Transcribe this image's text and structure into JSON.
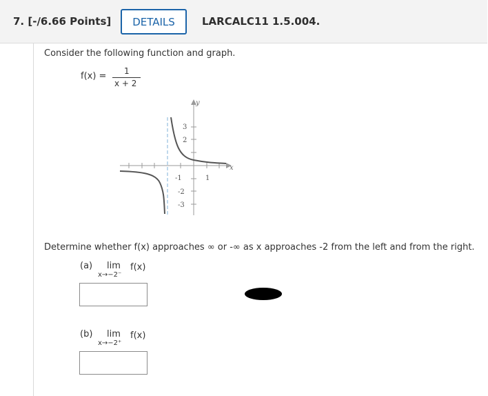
{
  "header": {
    "question_number": "7. [-/6.66 Points]",
    "details_label": "DETAILS",
    "problem_code": "LARCALC11 1.5.004."
  },
  "problem": {
    "intro": "Consider the following function and graph.",
    "function_lhs": "f(x) =",
    "numerator": "1",
    "denominator": "x + 2",
    "prompt": "Determine whether f(x) approaches ∞ or -∞ as x approaches -2 from the left and from the right."
  },
  "graph": {
    "axis_x_label": "x",
    "axis_y_label": "y",
    "x_tick_labels": [
      "-1",
      "1"
    ],
    "y_tick_labels": [
      "3",
      "2",
      "-2",
      "-3"
    ],
    "vertical_asymptote": -2,
    "function": "1/(x+2)"
  },
  "parts": [
    {
      "label": "(a)",
      "lim": "lim",
      "subscript": "x→−2⁻",
      "expr": "f(x)",
      "answer": ""
    },
    {
      "label": "(b)",
      "lim": "lim",
      "subscript": "x→−2⁺",
      "expr": "f(x)",
      "answer": ""
    }
  ]
}
